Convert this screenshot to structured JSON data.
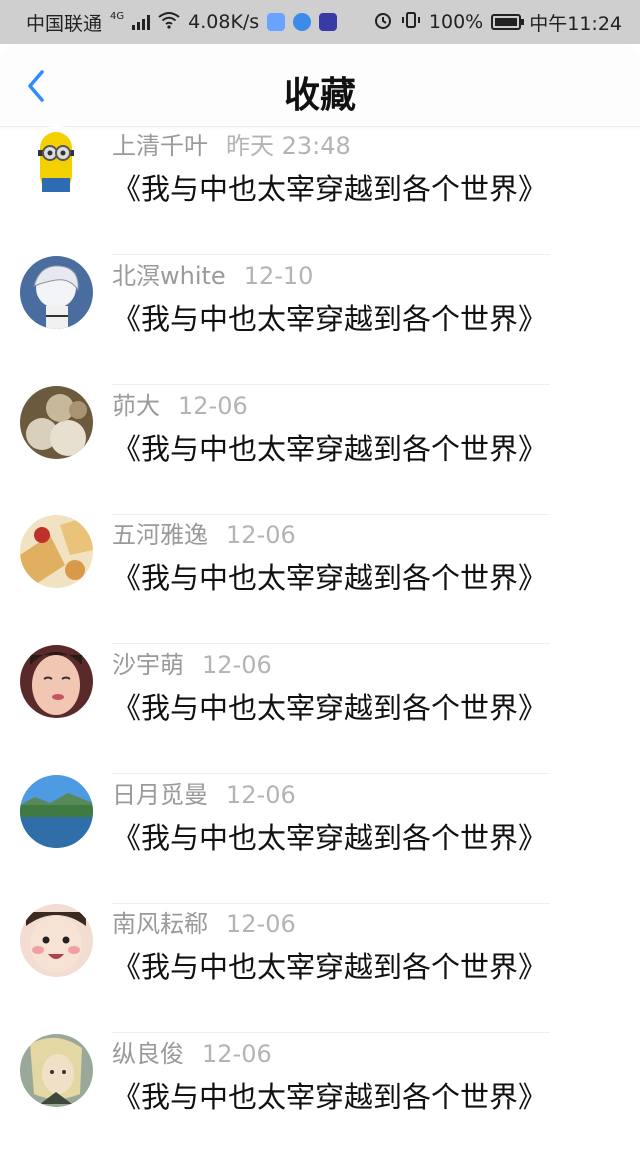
{
  "status_bar": {
    "carrier": "中国联通",
    "network": "4G",
    "speed": "4.08K/s",
    "battery": "100%",
    "time": "中午11:24"
  },
  "header": {
    "back_icon": "chevron-left-icon",
    "title": "收藏"
  },
  "colors": {
    "accent": "#2f8cff",
    "status_bar_bg": "#cfcfcf",
    "meta_text": "#9a9a9a",
    "body_text": "#111111"
  },
  "favorites": [
    {
      "name": "上清千叶",
      "date": "昨天 23:48",
      "content": "《我与中也太宰穿越到各个世界》"
    },
    {
      "name": "北溟white",
      "date": "12-10",
      "content": "《我与中也太宰穿越到各个世界》"
    },
    {
      "name": "茆大",
      "date": "12-06",
      "content": "《我与中也太宰穿越到各个世界》"
    },
    {
      "name": "五河雅逸",
      "date": "12-06",
      "content": "《我与中也太宰穿越到各个世界》"
    },
    {
      "name": "沙宇萌",
      "date": "12-06",
      "content": "《我与中也太宰穿越到各个世界》"
    },
    {
      "name": "日月觅曼",
      "date": "12-06",
      "content": "《我与中也太宰穿越到各个世界》"
    },
    {
      "name": "南风耘郗",
      "date": "12-06",
      "content": "《我与中也太宰穿越到各个世界》"
    },
    {
      "name": "纵良俊",
      "date": "12-06",
      "content": "《我与中也太宰穿越到各个世界》"
    }
  ]
}
